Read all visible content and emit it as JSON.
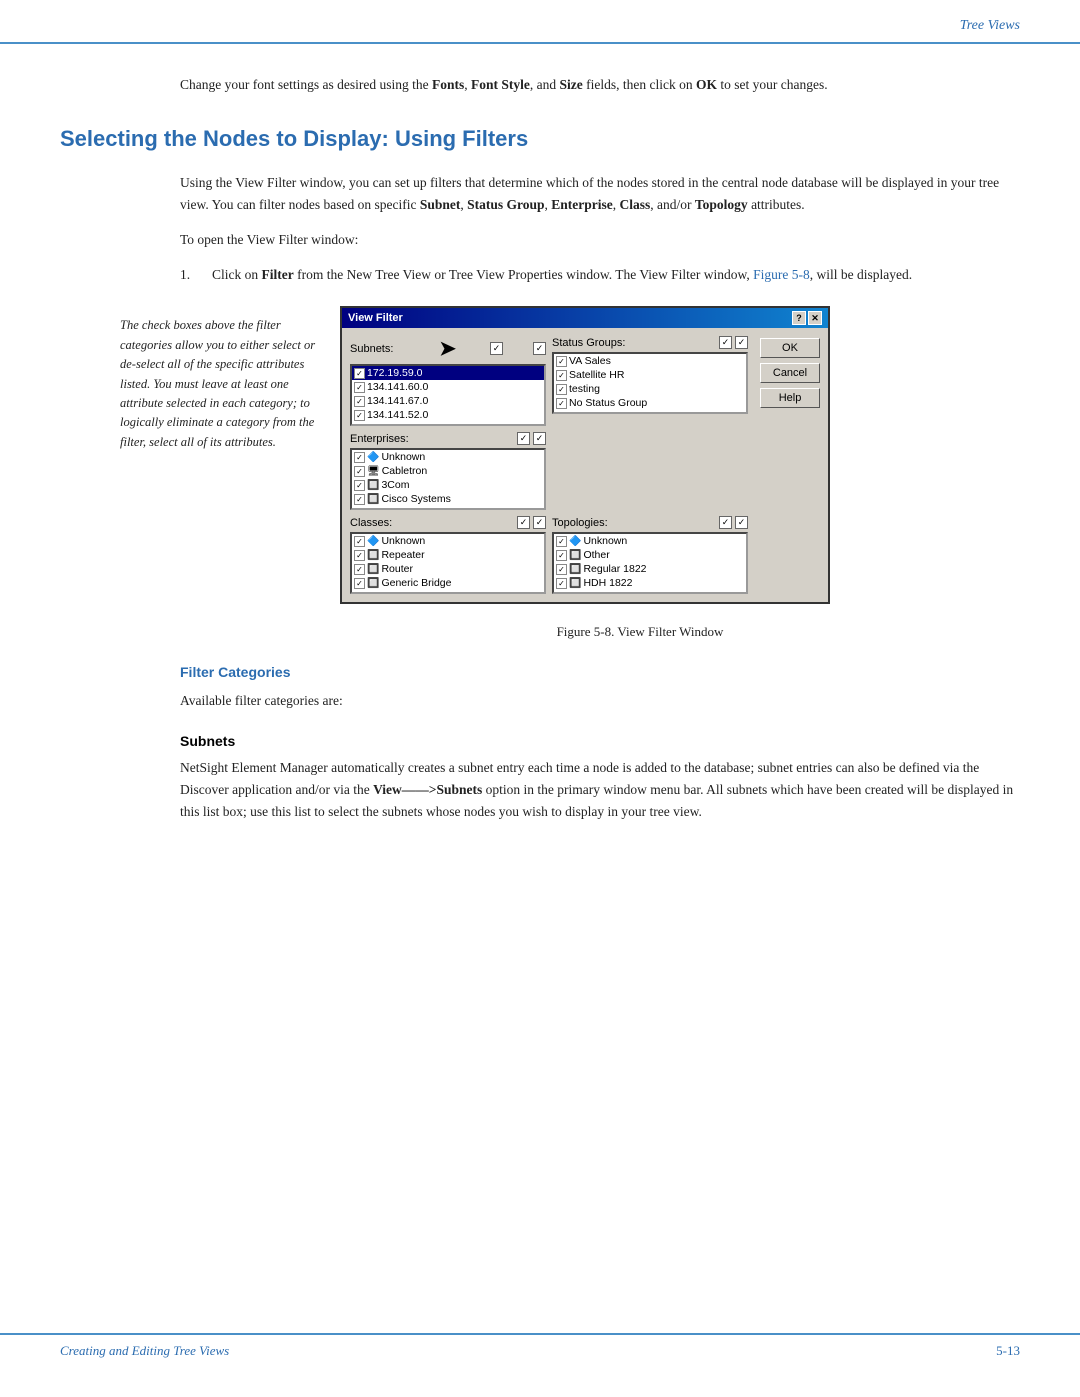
{
  "header": {
    "title": "Tree Views"
  },
  "intro": {
    "text": "Change your font settings as desired using the ",
    "bold1": "Fonts",
    "mid1": ", ",
    "bold2": "Font Style",
    "mid2": ", and ",
    "bold3": "Size",
    "end": " fields, then click on ",
    "bold4": "OK",
    "end2": " to set your changes."
  },
  "section_heading": "Selecting the Nodes to Display: Using Filters",
  "body1": {
    "text": "Using the View Filter window, you can set up filters that determine which of the nodes stored in the central node database will be displayed in your tree view. You can filter nodes based on specific ",
    "bold1": "Subnet",
    "m1": ", ",
    "bold2": "Status Group",
    "m2": ", ",
    "bold3": "Enterprise",
    "m3": ", ",
    "bold4": "Class",
    "m4": ", and/or ",
    "bold5": "Topology",
    "end": " attributes."
  },
  "to_open": "To open the View Filter window:",
  "step1": {
    "num": "1.",
    "text": "Click on ",
    "bold": "Filter",
    "end": " from the New Tree View or Tree View Properties window. The View Filter window, ",
    "link": "Figure 5-8",
    "end2": ", will be displayed."
  },
  "figure_note": {
    "line1": "The check boxes above",
    "line2": "the filter categories allow",
    "line3": "you to either select or",
    "line4": "de-select all of the specific",
    "line5": "attributes listed. You must",
    "line6": "leave at least one attribute",
    "line7": "selected in each category;",
    "line8": "to logically eliminate a",
    "line9": "category from the filter,",
    "line10": "select all of its attributes."
  },
  "view_filter_window": {
    "title": "View Filter",
    "title_buttons": [
      "?",
      "✕"
    ],
    "subnets_label": "Subnets:",
    "subnets_items": [
      {
        "checked": true,
        "label": "172.19.59.0",
        "selected": true
      },
      {
        "checked": true,
        "label": "134.141.60.0"
      },
      {
        "checked": true,
        "label": "134.141.67.0"
      },
      {
        "checked": true,
        "label": "134.141.52.0"
      }
    ],
    "status_groups_label": "Status Groups:",
    "status_groups_items": [
      {
        "checked": true,
        "label": "VA Sales"
      },
      {
        "checked": true,
        "label": "Satellite HR"
      },
      {
        "checked": true,
        "label": "testing"
      },
      {
        "checked": true,
        "label": "No Status Group"
      }
    ],
    "enterprises_label": "Enterprises:",
    "enterprises_items": [
      {
        "checked": true,
        "label": "Unknown",
        "icon": "🔷"
      },
      {
        "checked": true,
        "label": "Cabletron",
        "icon": "🖥"
      },
      {
        "checked": true,
        "label": "3Com",
        "icon": "🔲"
      },
      {
        "checked": true,
        "label": "Cisco Systems",
        "icon": "🔲"
      }
    ],
    "classes_label": "Classes:",
    "classes_items": [
      {
        "checked": true,
        "label": "Unknown",
        "icon": "🔷"
      },
      {
        "checked": true,
        "label": "Repeater",
        "icon": "🔲"
      },
      {
        "checked": true,
        "label": "Router",
        "icon": "🔲"
      },
      {
        "checked": true,
        "label": "Generic Bridge",
        "icon": "🔲"
      }
    ],
    "topologies_label": "Topologies:",
    "topologies_items": [
      {
        "checked": true,
        "label": "Unknown",
        "icon": "🔷"
      },
      {
        "checked": true,
        "label": "Other",
        "icon": "🔲"
      },
      {
        "checked": true,
        "label": "Regular 1822",
        "icon": "🔲"
      },
      {
        "checked": true,
        "label": "HDH 1822",
        "icon": "🔲"
      }
    ],
    "buttons": [
      "OK",
      "Cancel",
      "Help"
    ]
  },
  "figure_caption": "Figure 5-8.  View Filter Window",
  "filter_categories_heading": "Filter Categories",
  "available_text": "Available filter categories are:",
  "subnets_heading": "Subnets",
  "subnets_body": "NetSight Element Manager automatically creates a subnet entry each time a node is added to the database; subnet entries can also be defined via the Discover application and/or via the ",
  "subnets_bold": "View——>Subnets",
  "subnets_body2": " option in the primary window menu bar. All subnets which have been created will be displayed in this list box; use this list to select the subnets whose nodes you wish to display in your tree view.",
  "footer": {
    "left": "Creating and Editing Tree Views",
    "right": "5-13"
  }
}
